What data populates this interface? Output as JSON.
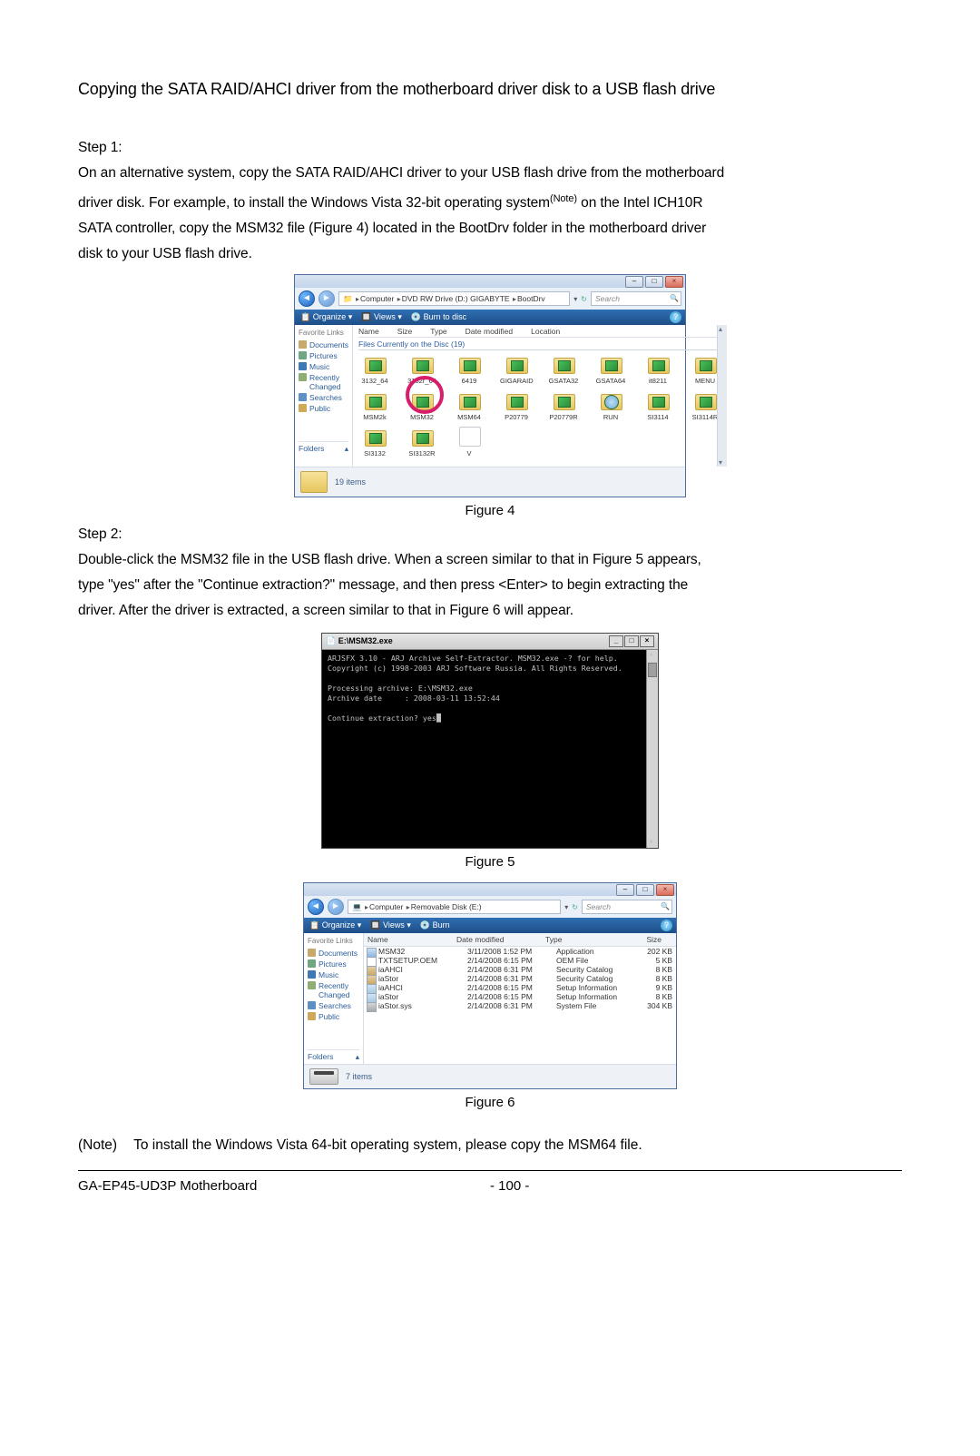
{
  "title": "Copying the SATA RAID/AHCI driver from the motherboard driver disk to a USB flash drive",
  "step1": {
    "label": "Step 1:",
    "l1": "On an alternative system, copy the SATA RAID/AHCI driver to your USB flash drive from the motherboard",
    "l2a": "driver disk. For example, to install the Windows Vista 32-bit operating system",
    "l2sup": "(Note)",
    "l2b": " on the Intel ICH10R",
    "l3a": "SATA controller, copy the ",
    "l3b": "MSM32",
    "l3c": " file (Figure 4) located in the ",
    "l3d": "BootDrv",
    "l3e": " folder in the motherboard driver",
    "l4": "disk to your USB flash drive."
  },
  "fig4": {
    "caption": "Figure 4",
    "breadcrumb": [
      "Computer",
      "DVD RW Drive (D:) GIGABYTE",
      "BootDrv"
    ],
    "search_placeholder": "Search",
    "toolbar": [
      "Organize ▾",
      "Views ▾",
      "Burn to disc"
    ],
    "side_header": "Favorite Links",
    "side_links": [
      "Documents",
      "Pictures",
      "Music",
      "Recently Changed",
      "Searches",
      "Public"
    ],
    "folders_label": "Folders",
    "col_headers": [
      "Name",
      "Size",
      "Type",
      "Date modified",
      "Location"
    ],
    "group_label": "Files Currently on the Disc (19)",
    "rows": [
      [
        "3132_64",
        "3132r_64",
        "6419",
        "GIGARAID",
        "GSATA32",
        "GSATA64",
        "it8211",
        "MENU"
      ],
      [
        "MSM2k",
        "MSM32",
        "MSM64",
        "P20779",
        "P20779R",
        "RUN",
        "SI3114",
        "SI3114R"
      ],
      [
        "SI3132",
        "SI3132R",
        "V"
      ]
    ],
    "status": "19 items"
  },
  "step2": {
    "label": "Step 2:",
    "l1a": "Double-click the ",
    "l1b": "MSM32",
    "l1c": " file in the USB flash drive. When a screen similar to that in Figure 5 appears,",
    "l2": "type \"yes\" after the \"Continue extraction?\" message, and then press <Enter> to begin extracting the",
    "l3": "driver. After the driver is extracted, a screen similar to that in Figure 6 will appear."
  },
  "fig5": {
    "caption": "Figure 5",
    "title": "E:\\MSM32.exe",
    "lines": [
      "ARJSFX 3.10 - ARJ Archive Self-Extractor. MSM32.exe -? for help.",
      "Copyright (c) 1998-2003 ARJ Software Russia. All Rights Reserved.",
      "",
      "Processing archive: E:\\MSM32.exe",
      "Archive date     : 2008-03-11 13:52:44",
      "",
      "Continue extraction? yes"
    ],
    "caret": "_"
  },
  "fig6": {
    "caption": "Figure 6",
    "breadcrumb": [
      "Computer",
      "Removable Disk (E:)"
    ],
    "search_placeholder": "Search",
    "toolbar": [
      "Organize ▾",
      "Views ▾",
      "Burn"
    ],
    "side_header": "Favorite Links",
    "side_links": [
      "Documents",
      "Pictures",
      "Music",
      "Recently Changed",
      "Searches",
      "Public"
    ],
    "folders_label": "Folders",
    "cols": [
      "Name",
      "Date modified",
      "Type",
      "Size"
    ],
    "rows": [
      {
        "cls": "exe",
        "name": "MSM32",
        "date": "3/11/2008 1:52 PM",
        "type": "Application",
        "size": "202 KB"
      },
      {
        "cls": "",
        "name": "TXTSETUP.OEM",
        "date": "2/14/2008 6:15 PM",
        "type": "OEM File",
        "size": "5 KB"
      },
      {
        "cls": "cat",
        "name": "iaAHCI",
        "date": "2/14/2008 6:31 PM",
        "type": "Security Catalog",
        "size": "8 KB"
      },
      {
        "cls": "cat",
        "name": "iaStor",
        "date": "2/14/2008 6:31 PM",
        "type": "Security Catalog",
        "size": "8 KB"
      },
      {
        "cls": "inf",
        "name": "iaAHCI",
        "date": "2/14/2008 6:15 PM",
        "type": "Setup Information",
        "size": "9 KB"
      },
      {
        "cls": "inf",
        "name": "iaStor",
        "date": "2/14/2008 6:15 PM",
        "type": "Setup Information",
        "size": "8 KB"
      },
      {
        "cls": "sys",
        "name": "iaStor.sys",
        "date": "2/14/2008 6:31 PM",
        "type": "System File",
        "size": "304 KB"
      }
    ],
    "status": "7 items"
  },
  "note": {
    "label": "(Note)",
    "text_a": "To install the Windows Vista 64-bit operating system, please copy the ",
    "text_b": "MSM64",
    "text_c": " file."
  },
  "footer": {
    "left": "GA-EP45-UD3P Motherboard",
    "center": "- 100 -"
  }
}
